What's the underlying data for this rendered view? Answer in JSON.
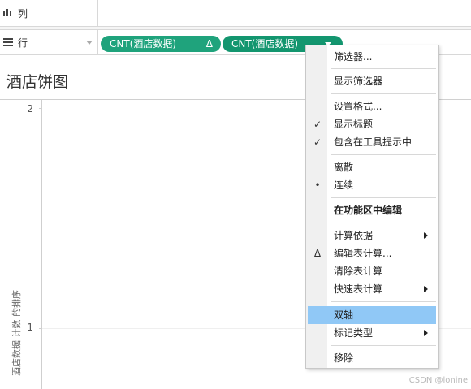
{
  "shelves": {
    "columns": {
      "label": "列"
    },
    "rows": {
      "label": "行"
    }
  },
  "pills": [
    {
      "label": "CNT(酒店数据)",
      "indicator": "Δ"
    },
    {
      "label": "CNT(酒店数据)"
    }
  ],
  "sheet": {
    "title": "酒店饼图"
  },
  "axis": {
    "title": "酒店数据 计数 的排序",
    "ticks": [
      "2",
      "1"
    ]
  },
  "context_menu": {
    "items": [
      {
        "label": "筛选器..."
      },
      {
        "label": "显示筛选器"
      },
      {
        "label": "设置格式..."
      },
      {
        "label": "显示标题",
        "mark": "✓"
      },
      {
        "label": "包含在工具提示中",
        "mark": "✓"
      },
      {
        "label": "离散"
      },
      {
        "label": "连续",
        "mark": "•"
      },
      {
        "label": "在功能区中编辑"
      },
      {
        "label": "计算依据"
      },
      {
        "label": "编辑表计算...",
        "mark": "Δ"
      },
      {
        "label": "清除表计算"
      },
      {
        "label": "快速表计算"
      },
      {
        "label": "双轴",
        "highlighted": true
      },
      {
        "label": "标记类型"
      },
      {
        "label": "移除"
      }
    ]
  },
  "colors": {
    "pill": "#1fa37c",
    "menu_highlight": "#90c8f6"
  },
  "icons": [
    "columns-icon",
    "rows-icon",
    "delta-icon",
    "dropdown-caret-icon",
    "check-icon",
    "bullet-icon",
    "submenu-arrow-icon"
  ],
  "watermark": "CSDN @lonine"
}
